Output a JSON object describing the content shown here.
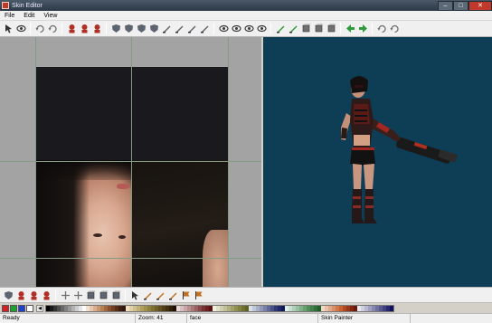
{
  "window": {
    "title": "Skin Editor"
  },
  "menu": [
    "File",
    "Edit",
    "View"
  ],
  "toolbar_top": [
    "pointer-tool-icon",
    "eyedropper-tool-icon",
    "undo-icon",
    "redo-icon",
    "bodypart-head-icon",
    "bodypart-torso-icon",
    "bodypart-arms-icon",
    "shield-front-icon",
    "shield-back-icon",
    "shield-left-icon",
    "shield-right-icon",
    "view-front-icon",
    "view-back-icon",
    "view-side-icon",
    "view-top-icon",
    "eye-icon",
    "camera-icon",
    "camera-rotate-icon",
    "camera-reset-icon",
    "map-export-icon",
    "map-import-icon",
    "layer-new-icon",
    "layer-copy-icon",
    "layer-merge-icon",
    "arrow-left-icon",
    "arrow-right-icon",
    "mirror-icon",
    "flip-icon"
  ],
  "toolbar_bottom": [
    "shield-icon",
    "head-icon",
    "face-icon",
    "helmet-icon",
    "move-icon",
    "link-icon",
    "cube-icon",
    "box-icon",
    "cube-solid-icon",
    "select-tool-icon",
    "pencil-icon",
    "brush-icon",
    "fill-icon",
    "flag-icon",
    "flag-alt-icon"
  ],
  "palette": {
    "current_colors": [
      "#d42020",
      "#20a030",
      "#2040d0",
      "#ffffff"
    ],
    "swatches": [
      "#000000",
      "#1a1a1a",
      "#333333",
      "#4d4d4d",
      "#666666",
      "#808080",
      "#999999",
      "#b3b3b3",
      "#cccccc",
      "#e6e6e6",
      "#ffffff",
      "#f2e0d0",
      "#e8c8b0",
      "#d8b090",
      "#c89870",
      "#b88050",
      "#a06840",
      "#885030",
      "#704020",
      "#583018",
      "#402010",
      "#301810",
      "#f0e0c0",
      "#e0d0a8",
      "#d0c090",
      "#c0b078",
      "#b0a060",
      "#a09050",
      "#908040",
      "#807030",
      "#706028",
      "#605020",
      "#504018",
      "#403010",
      "#302008",
      "#201000",
      "#e8d8d8",
      "#d8c0c0",
      "#c8a8a8",
      "#b89090",
      "#a87878",
      "#986060",
      "#884848",
      "#783030",
      "#682020",
      "#581010",
      "#f0f0e0",
      "#e0e0c8",
      "#d0d0b0",
      "#c0c098",
      "#b0b080",
      "#a0a068",
      "#909050",
      "#808040",
      "#707030",
      "#606020",
      "#d8e0e8",
      "#c0c8d8",
      "#a8b0c8",
      "#9098b8",
      "#7880a8",
      "#606898",
      "#485088",
      "#303878",
      "#202868",
      "#101858",
      "#e0f0e8",
      "#c8e0d0",
      "#b0d0b8",
      "#98c0a0",
      "#80b088",
      "#68a070",
      "#509058",
      "#408048",
      "#307038",
      "#206028",
      "#f0d8c8",
      "#e8c0a8",
      "#e0a888",
      "#d89068",
      "#d07848",
      "#c86030",
      "#b04820",
      "#983818",
      "#802810",
      "#681808",
      "#e8e8f0",
      "#d0d0e0",
      "#b8b8d0",
      "#a0a0c0",
      "#8888b0",
      "#7070a0",
      "#585890",
      "#404080",
      "#282870",
      "#101060"
    ]
  },
  "status": {
    "state": "Ready",
    "zoom": "Zoom: 41",
    "part": "face",
    "mode": "Skin Painter"
  }
}
